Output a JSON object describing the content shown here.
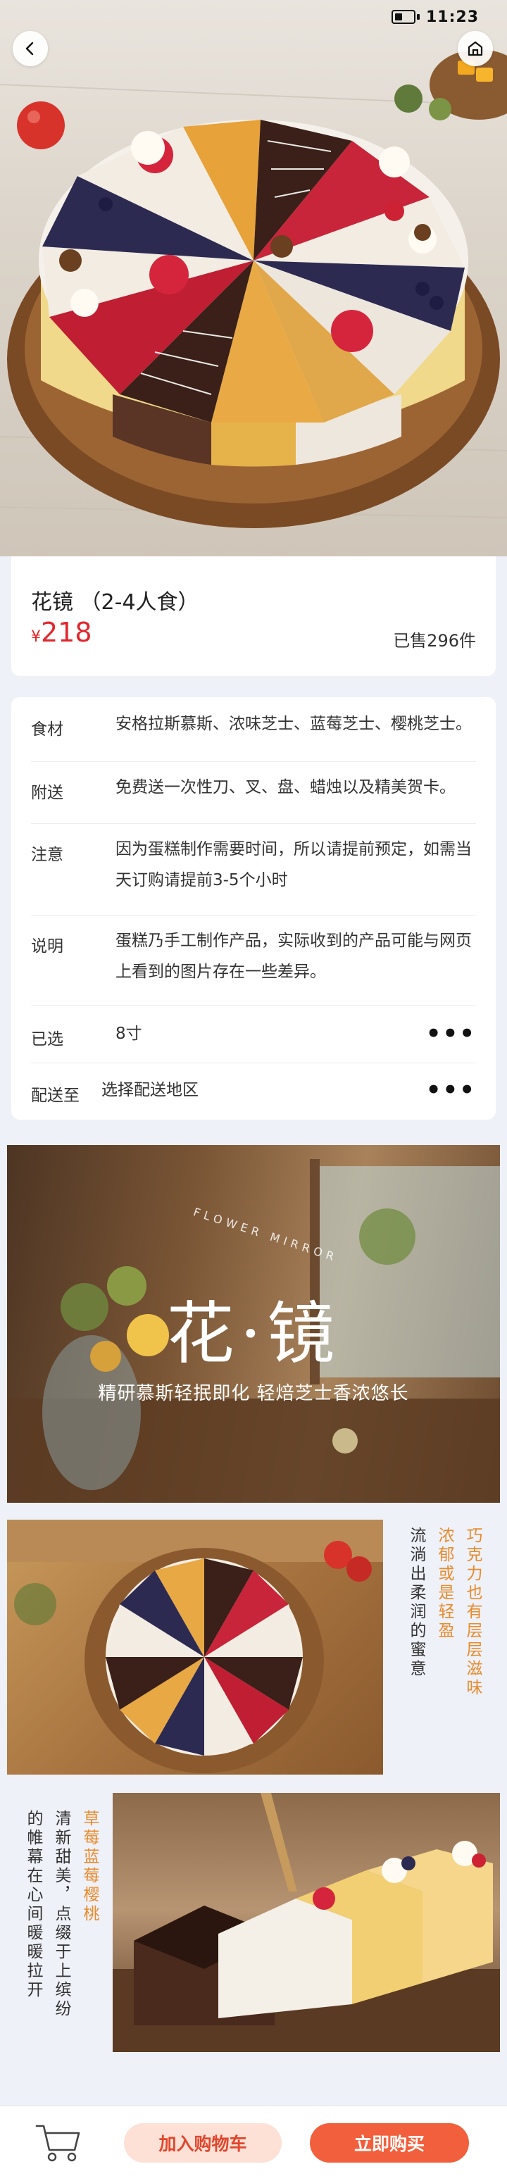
{
  "status_bar": {
    "time": "11:23"
  },
  "nav": {
    "back_icon": "chevron-left-icon",
    "home_icon": "home-icon"
  },
  "product": {
    "name": "花镜  （2-4人食）",
    "currency": "¥",
    "price": "218",
    "sold": "已售296件"
  },
  "details": [
    {
      "label": "食材",
      "value": "安格拉斯慕斯、浓味芝士、蓝莓芝士、樱桃芝士。"
    },
    {
      "label": "附送",
      "value": "免费送一次性刀、叉、盘、蜡烛以及精美贺卡。"
    },
    {
      "label": "注意",
      "value": "因为蛋糕制作需要时间，所以请提前预定，如需当天订购请提前3-5个小时"
    },
    {
      "label": "说明",
      "value": "蛋糕乃手工制作产品，实际收到的产品可能与网页上看到的图片存在一些差异。"
    },
    {
      "label": "已选",
      "value": "8寸"
    },
    {
      "label": "配送至",
      "value": "选择配送地区"
    }
  ],
  "banner": {
    "title": "花·镜",
    "subtitle": "精研慕斯轻抿即化 轻焙芝士香浓悠长",
    "english": "FLOWER MIRROR"
  },
  "section2": {
    "col1": "巧克力也有层层滋味",
    "col2": "浓郁或是轻盈",
    "col3": "流淌出柔润的蜜意"
  },
  "section3": {
    "col1": "草莓蓝莓樱桃",
    "col2": "清新甜美，点缀于上缤纷",
    "col3": "的帷幕在心间暖暖拉开"
  },
  "bottom": {
    "add_to_cart": "加入购物车",
    "buy_now": "立即购买"
  }
}
